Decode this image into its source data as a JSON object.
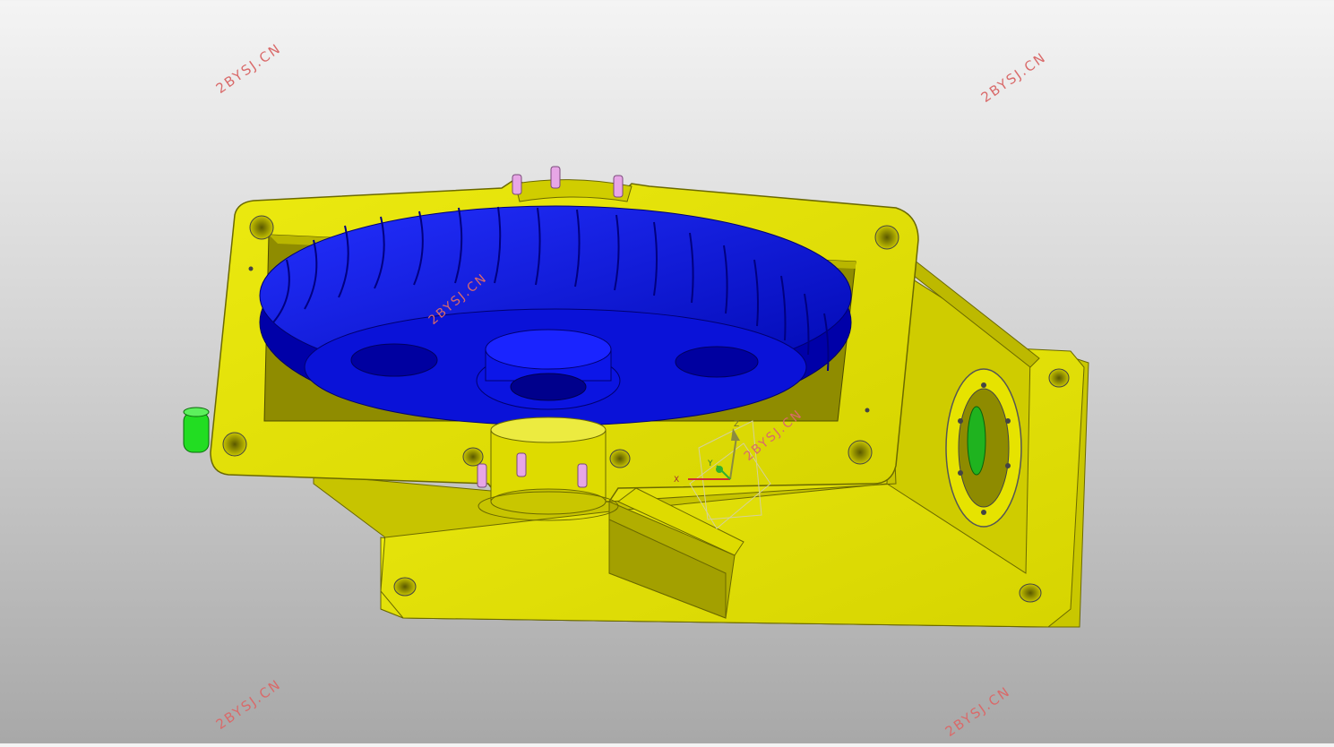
{
  "watermarks": {
    "text": "2BYSJ.CN"
  },
  "colors": {
    "housing": "#e2e000",
    "housing_dark": "#a8a400",
    "housing_shadow": "#8a8700",
    "gear": "#0a14e6",
    "gear_dark": "#00008c",
    "pin": "#e7a6e6",
    "knob": "#22dd22",
    "watermark": "#d96a6a"
  },
  "axis_labels": {
    "x": "X",
    "y": "Y",
    "z": "Z"
  }
}
